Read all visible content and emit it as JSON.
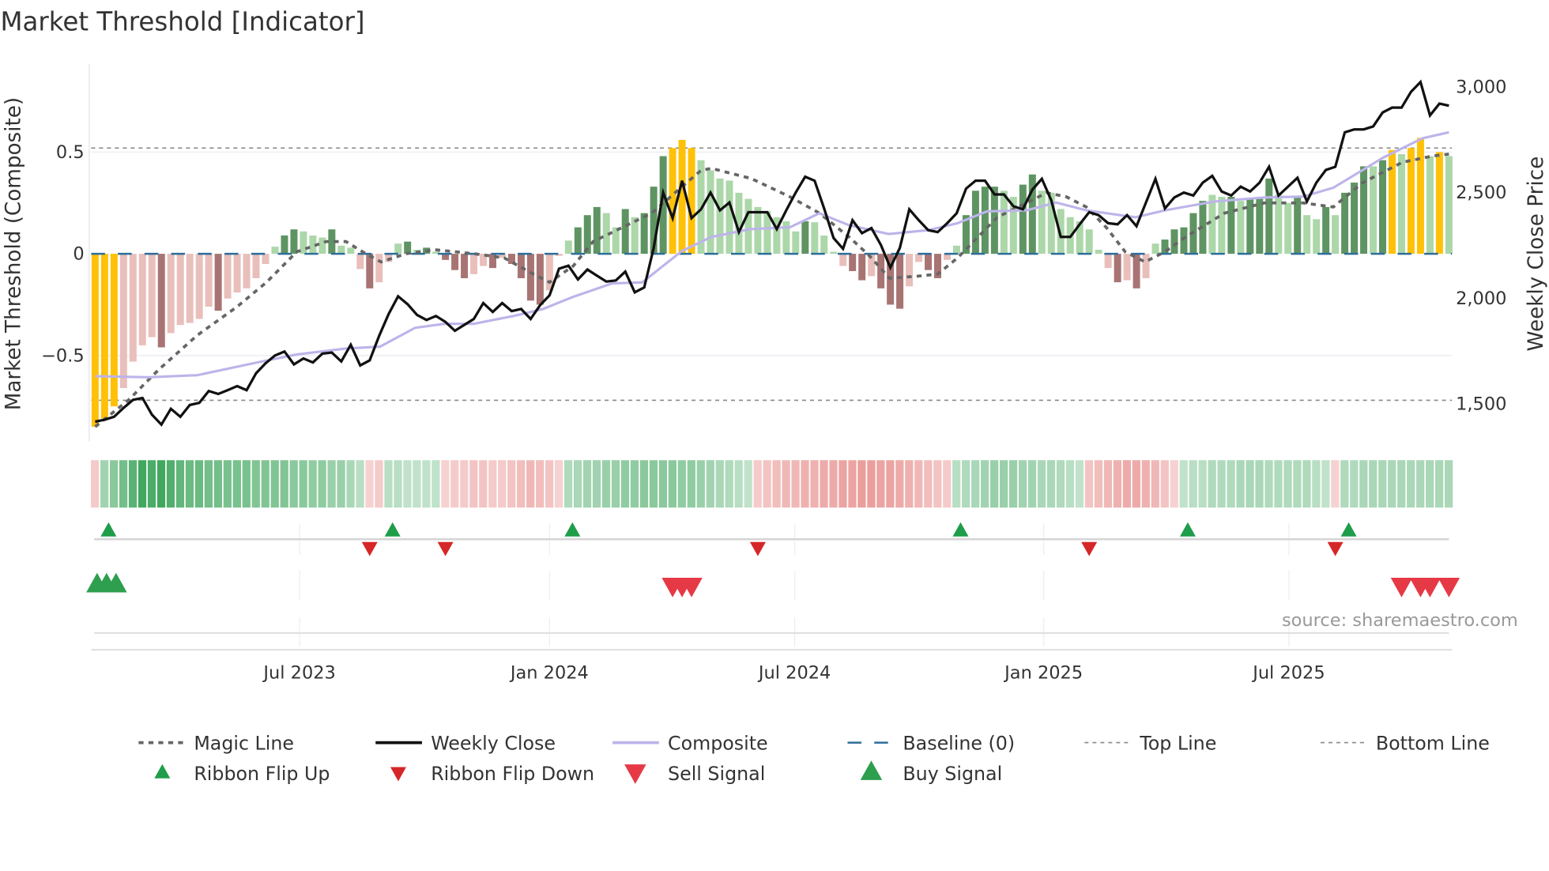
{
  "chart_data": {
    "type": "bar",
    "title": "Market Threshold [Indicator]",
    "ylabel": "Market Threshold (Composite)",
    "ylabel_right": "Weekly Close Price",
    "source": "source: sharemaestro.com",
    "ylim": [
      -0.91,
      0.93
    ],
    "ylim_right": [
      1332,
      3108
    ],
    "left_ticks": [
      {
        "value": 0.5,
        "label": "0.5"
      },
      {
        "value": 0,
        "label": "0"
      },
      {
        "value": -0.5,
        "label": "−0.5"
      }
    ],
    "right_ticks": [
      {
        "value": 3000,
        "label": "3,000"
      },
      {
        "value": 2500,
        "label": "2,500"
      },
      {
        "value": 2000,
        "label": "2,000"
      },
      {
        "value": 1500,
        "label": "1,500"
      }
    ],
    "x_ticks": [
      {
        "label": "Jul 2023",
        "week": 21.6
      },
      {
        "label": "Jan 2024",
        "week": 48.0
      },
      {
        "label": "Jul 2024",
        "week": 73.9
      },
      {
        "label": "Jan 2025",
        "week": 100.2
      },
      {
        "label": "Jul 2025",
        "week": 126.1
      }
    ],
    "top_line": 0.52,
    "bottom_line": -0.72,
    "baseline": 0,
    "colors": {
      "y": "#FFC107",
      "g": "#5E9462",
      "l": "#ACD7A9",
      "r": "#A87473",
      "p": "#E9BFBB",
      "close": "#111111",
      "composite": "#BDB4EA",
      "magic": "#666666",
      "baseline": "#2C6E9A",
      "ribbon_up": "#2E9E4F",
      "ribbon_down": "#D9534F",
      "flip_up": "#1F9D4A",
      "flip_down": "#D62728",
      "sell": "#E63946",
      "buy": "#2E9E4F"
    },
    "composite_bars": [
      -0.85,
      -0.81,
      -0.75,
      -0.66,
      -0.53,
      -0.45,
      -0.41,
      -0.46,
      -0.39,
      -0.35,
      -0.34,
      -0.32,
      -0.26,
      -0.28,
      -0.22,
      -0.19,
      -0.17,
      -0.12,
      -0.05,
      0.035,
      0.09,
      0.12,
      0.11,
      0.09,
      0.08,
      0.12,
      0.04,
      0.03,
      -0.075,
      -0.17,
      -0.14,
      -0.04,
      0.05,
      0.06,
      0.02,
      0.03,
      0.01,
      -0.03,
      -0.08,
      -0.12,
      -0.1,
      -0.06,
      -0.07,
      -0.02,
      -0.05,
      -0.12,
      -0.23,
      -0.25,
      -0.18,
      -0.01,
      0.065,
      0.13,
      0.19,
      0.23,
      0.2,
      0.13,
      0.22,
      0.18,
      0.2,
      0.33,
      0.48,
      0.52,
      0.56,
      0.52,
      0.46,
      0.41,
      0.37,
      0.36,
      0.3,
      0.27,
      0.23,
      0.21,
      0.18,
      0.16,
      0.11,
      0.16,
      0.155,
      0.09,
      0.01,
      -0.06,
      -0.085,
      -0.13,
      -0.11,
      -0.17,
      -0.25,
      -0.27,
      -0.16,
      -0.04,
      -0.08,
      -0.12,
      -0.03,
      0.04,
      0.19,
      0.31,
      0.33,
      0.33,
      0.31,
      0.28,
      0.34,
      0.39,
      0.31,
      0.3,
      0.22,
      0.18,
      0.16,
      0.12,
      0.02,
      -0.07,
      -0.14,
      -0.13,
      -0.17,
      -0.12,
      0.05,
      0.07,
      0.12,
      0.13,
      0.2,
      0.26,
      0.29,
      0.28,
      0.28,
      0.26,
      0.27,
      0.27,
      0.37,
      0.29,
      0.25,
      0.28,
      0.19,
      0.17,
      0.23,
      0.19,
      0.3,
      0.35,
      0.43,
      0.43,
      0.46,
      0.51,
      0.49,
      0.52,
      0.57,
      0.48,
      0.5,
      0.48
    ],
    "bar_state_list": [
      "y",
      "y",
      "y",
      "p",
      "p",
      "p",
      "p",
      "r",
      "p",
      "p",
      "p",
      "p",
      "p",
      "r",
      "p",
      "p",
      "p",
      "p",
      "p",
      "l",
      "g",
      "g",
      "l",
      "l",
      "l",
      "g",
      "l",
      "l",
      "p",
      "r",
      "p",
      "p",
      "l",
      "g",
      "l",
      "g",
      "l",
      "r",
      "r",
      "r",
      "p",
      "p",
      "r",
      "p",
      "r",
      "r",
      "r",
      "r",
      "p",
      "p",
      "l",
      "g",
      "g",
      "g",
      "l",
      "l",
      "g",
      "l",
      "g",
      "g",
      "g",
      "y",
      "y",
      "y",
      "l",
      "l",
      "l",
      "l",
      "l",
      "l",
      "l",
      "l",
      "l",
      "l",
      "l",
      "g",
      "l",
      "l",
      "l",
      "p",
      "r",
      "r",
      "p",
      "r",
      "r",
      "r",
      "p",
      "p",
      "r",
      "r",
      "p",
      "l",
      "g",
      "g",
      "g",
      "g",
      "l",
      "l",
      "g",
      "g",
      "l",
      "l",
      "l",
      "l",
      "l",
      "l",
      "l",
      "p",
      "r",
      "p",
      "r",
      "p",
      "l",
      "g",
      "g",
      "g",
      "g",
      "g",
      "l",
      "l",
      "g",
      "l",
      "g",
      "g",
      "g",
      "l",
      "l",
      "g",
      "l",
      "l",
      "g",
      "l",
      "g",
      "g",
      "g",
      "l",
      "g",
      "y",
      "l",
      "y",
      "y",
      "l",
      "y",
      "l"
    ],
    "weekly_close": [
      1416,
      1425,
      1439,
      1481,
      1519,
      1528,
      1449,
      1402,
      1477,
      1439,
      1495,
      1505,
      1561,
      1547,
      1565,
      1584,
      1565,
      1645,
      1692,
      1729,
      1748,
      1687,
      1715,
      1696,
      1738,
      1743,
      1701,
      1780,
      1682,
      1706,
      1822,
      1925,
      2009,
      1972,
      1921,
      1897,
      1916,
      1888,
      1846,
      1874,
      1902,
      1977,
      1935,
      1977,
      1939,
      1949,
      1902,
      1967,
      2014,
      2140,
      2154,
      2089,
      2136,
      2107,
      2079,
      2084,
      2126,
      2028,
      2051,
      2238,
      2500,
      2379,
      2556,
      2379,
      2421,
      2500,
      2416,
      2453,
      2313,
      2407,
      2407,
      2407,
      2327,
      2416,
      2500,
      2575,
      2556,
      2425,
      2285,
      2234,
      2369,
      2308,
      2332,
      2252,
      2145,
      2238,
      2421,
      2369,
      2322,
      2313,
      2355,
      2402,
      2519,
      2556,
      2556,
      2491,
      2491,
      2435,
      2421,
      2514,
      2565,
      2463,
      2290,
      2290,
      2350,
      2407,
      2393,
      2355,
      2350,
      2393,
      2341,
      2453,
      2565,
      2425,
      2477,
      2500,
      2486,
      2547,
      2579,
      2505,
      2486,
      2528,
      2505,
      2547,
      2622,
      2486,
      2528,
      2570,
      2458,
      2547,
      2607,
      2622,
      2785,
      2799,
      2799,
      2813,
      2879,
      2902,
      2902,
      2977,
      3023,
      2865,
      2921,
      2911
    ],
    "composite_line": [
      [
        0,
        1631
      ],
      [
        5.6,
        1626
      ],
      [
        10.8,
        1636
      ],
      [
        17.1,
        1696
      ],
      [
        21.3,
        1734
      ],
      [
        26.5,
        1762
      ],
      [
        30.1,
        1771
      ],
      [
        33.8,
        1860
      ],
      [
        36.9,
        1879
      ],
      [
        40,
        1879
      ],
      [
        44.2,
        1916
      ],
      [
        47.3,
        1949
      ],
      [
        50.4,
        2005
      ],
      [
        54.6,
        2070
      ],
      [
        57.8,
        2075
      ],
      [
        59.9,
        2150
      ],
      [
        62,
        2224
      ],
      [
        65.1,
        2290
      ],
      [
        69.2,
        2327
      ],
      [
        73.4,
        2336
      ],
      [
        76.5,
        2402
      ],
      [
        79.6,
        2346
      ],
      [
        83.8,
        2304
      ],
      [
        88,
        2322
      ],
      [
        91.1,
        2355
      ],
      [
        94.2,
        2411
      ],
      [
        98.4,
        2416
      ],
      [
        101.5,
        2453
      ],
      [
        104.7,
        2416
      ],
      [
        109.9,
        2383
      ],
      [
        113,
        2416
      ],
      [
        118.3,
        2458
      ],
      [
        123.5,
        2477
      ],
      [
        127.6,
        2481
      ],
      [
        130.8,
        2523
      ],
      [
        133.9,
        2607
      ],
      [
        136,
        2664
      ],
      [
        140.2,
        2757
      ],
      [
        143,
        2785
      ]
    ],
    "magic_line": [
      [
        0,
        -0.85
      ],
      [
        3.5,
        -0.72
      ],
      [
        6.7,
        -0.57
      ],
      [
        10.8,
        -0.4
      ],
      [
        15,
        -0.26
      ],
      [
        18.1,
        -0.14
      ],
      [
        21.3,
        0.01
      ],
      [
        24.4,
        0.06
      ],
      [
        26.5,
        0.06
      ],
      [
        28.6,
        0
      ],
      [
        30.2,
        -0.04
      ],
      [
        32.8,
        0
      ],
      [
        35.9,
        0.02
      ],
      [
        40.1,
        0
      ],
      [
        43.2,
        -0.02
      ],
      [
        46.3,
        -0.1
      ],
      [
        48,
        -0.14
      ],
      [
        50.5,
        -0.06
      ],
      [
        52.6,
        0.06
      ],
      [
        55.7,
        0.13
      ],
      [
        58.8,
        0.2
      ],
      [
        62,
        0.33
      ],
      [
        64,
        0.41
      ],
      [
        65.1,
        0.42
      ],
      [
        69.3,
        0.37
      ],
      [
        73.4,
        0.28
      ],
      [
        76.5,
        0.2
      ],
      [
        79.7,
        0.08
      ],
      [
        81.8,
        -0.01
      ],
      [
        83.9,
        -0.12
      ],
      [
        86.9,
        -0.11
      ],
      [
        89,
        -0.1
      ],
      [
        91.1,
        -0.02
      ],
      [
        93.2,
        0.08
      ],
      [
        95.3,
        0.18
      ],
      [
        98.4,
        0.25
      ],
      [
        100.5,
        0.3
      ],
      [
        102.6,
        0.28
      ],
      [
        104.7,
        0.23
      ],
      [
        106.8,
        0.13
      ],
      [
        108.8,
        0.01
      ],
      [
        110.9,
        -0.04
      ],
      [
        113,
        0.01
      ],
      [
        115.1,
        0.08
      ],
      [
        119.3,
        0.2
      ],
      [
        123.5,
        0.25
      ],
      [
        127.6,
        0.25
      ],
      [
        130.8,
        0.23
      ],
      [
        133.9,
        0.35
      ],
      [
        138.1,
        0.45
      ],
      [
        141.2,
        0.48
      ],
      [
        143,
        0.49
      ]
    ],
    "ribbon": [
      -0.2,
      0.4,
      0.55,
      0.7,
      0.85,
      1,
      0.95,
      1,
      0.9,
      0.8,
      0.75,
      0.75,
      0.7,
      0.7,
      0.65,
      0.65,
      0.65,
      0.6,
      0.6,
      0.6,
      0.6,
      0.55,
      0.55,
      0.5,
      0.5,
      0.45,
      0.45,
      0.35,
      0.25,
      -0.15,
      -0.2,
      0.25,
      0.25,
      0.2,
      0.2,
      0.2,
      0.2,
      -0.15,
      -0.2,
      -0.2,
      -0.25,
      -0.25,
      -0.2,
      -0.2,
      -0.25,
      -0.3,
      -0.35,
      -0.3,
      -0.25,
      -0.15,
      0.3,
      0.35,
      0.4,
      0.4,
      0.45,
      0.45,
      0.5,
      0.5,
      0.55,
      0.55,
      0.55,
      0.55,
      0.5,
      0.5,
      0.45,
      0.4,
      0.35,
      0.3,
      0.25,
      0.2,
      -0.2,
      -0.25,
      -0.3,
      -0.35,
      -0.35,
      -0.4,
      -0.4,
      -0.45,
      -0.45,
      -0.5,
      -0.5,
      -0.55,
      -0.55,
      -0.5,
      -0.5,
      -0.45,
      -0.4,
      -0.35,
      -0.3,
      -0.25,
      -0.2,
      0.25,
      0.3,
      0.35,
      0.4,
      0.45,
      0.45,
      0.45,
      0.4,
      0.4,
      0.35,
      0.35,
      0.3,
      0.25,
      0.2,
      -0.25,
      -0.3,
      -0.35,
      -0.4,
      -0.45,
      -0.45,
      -0.4,
      -0.35,
      -0.25,
      -0.15,
      0.2,
      0.25,
      0.25,
      0.3,
      0.3,
      0.3,
      0.35,
      0.35,
      0.35,
      0.3,
      0.3,
      0.3,
      0.3,
      0.3,
      0.25,
      0.2,
      -0.15,
      0.3,
      0.3,
      0.35,
      0.35,
      0.35,
      0.35,
      0.35,
      0.35,
      0.35,
      0.35,
      0.35,
      0.35
    ],
    "ribbon_flip_up": [
      1,
      31,
      50,
      91,
      115,
      132
    ],
    "ribbon_flip_down": [
      29,
      37,
      70,
      105,
      131
    ],
    "buy_signals": [
      0,
      1,
      2
    ],
    "sell_signals": [
      61,
      62,
      63,
      138,
      140,
      141,
      143
    ],
    "legend": [
      {
        "key": "magic",
        "label": "Magic Line"
      },
      {
        "key": "close",
        "label": "Weekly Close"
      },
      {
        "key": "composite",
        "label": "Composite"
      },
      {
        "key": "baseline",
        "label": "Baseline (0)"
      },
      {
        "key": "top",
        "label": "Top Line"
      },
      {
        "key": "bottom",
        "label": "Bottom Line"
      },
      {
        "key": "flip_up",
        "label": "Ribbon Flip Up"
      },
      {
        "key": "flip_down",
        "label": "Ribbon Flip Down"
      },
      {
        "key": "sell",
        "label": "Sell Signal"
      },
      {
        "key": "buy",
        "label": "Buy Signal"
      }
    ]
  }
}
